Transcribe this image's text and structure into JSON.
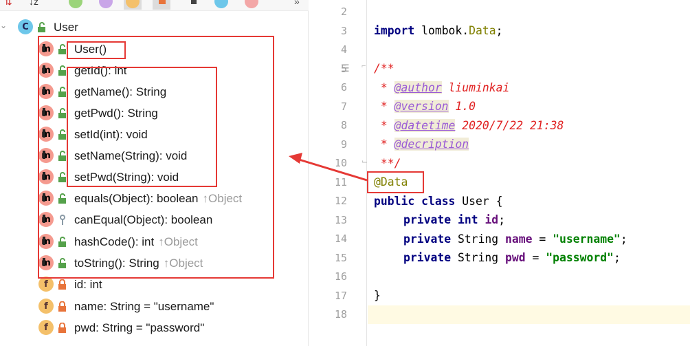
{
  "structure": {
    "class_name": "User",
    "members": [
      {
        "kind": "m",
        "label": "User()",
        "inherited": ""
      },
      {
        "kind": "m",
        "label": "getId(): int",
        "inherited": ""
      },
      {
        "kind": "m",
        "label": "getName(): String",
        "inherited": ""
      },
      {
        "kind": "m",
        "label": "getPwd(): String",
        "inherited": ""
      },
      {
        "kind": "m",
        "label": "setId(int): void",
        "inherited": ""
      },
      {
        "kind": "m",
        "label": "setName(String): void",
        "inherited": ""
      },
      {
        "kind": "m",
        "label": "setPwd(String): void",
        "inherited": ""
      },
      {
        "kind": "m",
        "label": "equals(Object): boolean",
        "inherited": "↑Object"
      },
      {
        "kind": "m",
        "label": "canEqual(Object): boolean",
        "inherited": ""
      },
      {
        "kind": "m",
        "label": "hashCode(): int",
        "inherited": "↑Object"
      },
      {
        "kind": "m",
        "label": "toString(): String",
        "inherited": "↑Object"
      },
      {
        "kind": "f",
        "label": "id: int",
        "inherited": ""
      },
      {
        "kind": "f",
        "label": "name: String = \"username\"",
        "inherited": ""
      },
      {
        "kind": "f",
        "label": "pwd: String = \"password\"",
        "inherited": ""
      }
    ],
    "icons": {
      "method": "m",
      "field": "f",
      "class": "C"
    }
  },
  "editor": {
    "line_numbers": [
      "2",
      "3",
      "4",
      "5",
      "6",
      "7",
      "8",
      "9",
      "10",
      "11",
      "12",
      "13",
      "14",
      "15",
      "16",
      "17",
      "18"
    ],
    "code": {
      "l3_import": "import",
      "l3_pkg": " lombok.",
      "l3_cls": "Data",
      "l3_end": ";",
      "l5": "/**",
      "l6_star": " * ",
      "l6_tag": "@author",
      "l6_val": " liuminkai",
      "l7_star": " * ",
      "l7_tag": "@version",
      "l7_val": " 1.0",
      "l8_star": " * ",
      "l8_tag": "@datetime",
      "l8_val": " 2020/7/22 21:38",
      "l9_star": " * ",
      "l9_tag": "@decription",
      "l10": " **/",
      "l11": "@Data",
      "l12_public": "public",
      "l12_class": " class",
      "l12_rest": " User {",
      "private": "private",
      "int": "int",
      "l13_field": "id",
      "l14_type": " String ",
      "l14_field": "name",
      "l14_eq": " = ",
      "l14_str": "\"username\"",
      "l15_type": " String ",
      "l15_field": "pwd",
      "l15_eq": " = ",
      "l15_str": "\"password\"",
      "semi": ";",
      "l17": "}"
    }
  },
  "colors": {
    "annotation_box": "#e53935",
    "arrow": "#e53935",
    "current_line": "#fffae3"
  }
}
